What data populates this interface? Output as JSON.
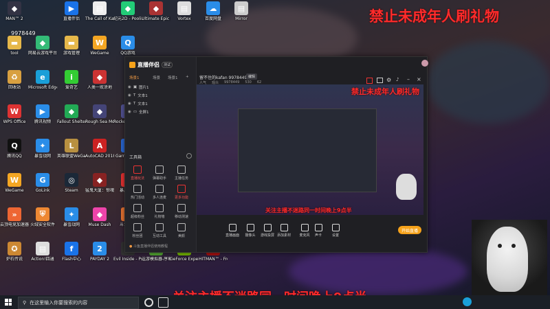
{
  "overlay": {
    "top_right_text": "禁止未成年人刷礼物",
    "preview_text": "禁止未成年人刷礼物",
    "bottom_text": "关注主播不迷路同一时间晚上9点半",
    "bottom_preview_text": "关注主播不迷路同一时间晚上9点半",
    "top_left_number": "9978449"
  },
  "desktop": {
    "icons": [
      {
        "label": "MAN™ 2",
        "icon": "game-icon",
        "color": "#334"
      },
      {
        "label": "直播伴侣",
        "icon": "stream-icon",
        "color": "#1a73e8"
      },
      {
        "label": "The Call of Karen",
        "icon": "doc-icon",
        "color": "#eee"
      },
      {
        "label": "纪元2D - Poolians",
        "icon": "game-icon",
        "color": "#2c7"
      },
      {
        "label": "Ultimate Epic Batt...",
        "icon": "game-icon",
        "color": "#a33"
      },
      {
        "label": "Vortex",
        "icon": "doc-icon",
        "color": "#ddd"
      },
      {
        "label": "百度网盘",
        "icon": "cloud-icon",
        "color": "#2a8de8"
      },
      {
        "label": "Mirror",
        "icon": "doc-icon",
        "color": "#ccc"
      },
      {
        "label": "tool",
        "icon": "folder-icon",
        "color": "#e6b84a"
      },
      {
        "label": "网易云游戏平台",
        "icon": "game-icon",
        "color": "#3b7"
      },
      {
        "label": "游戏管理",
        "icon": "folder-icon",
        "color": "#e6b84a"
      },
      {
        "label": "WeGame",
        "icon": "wegame-icon",
        "color": "#f4a623"
      },
      {
        "label": "QQ游戏",
        "icon": "qq-icon",
        "color": "#2a8de8"
      },
      {
        "label": "回收站",
        "icon": "recycle-icon",
        "color": "#d8a040"
      },
      {
        "label": "Microsoft Edge",
        "icon": "edge-icon",
        "color": "#1a9fd8"
      },
      {
        "label": "爱奇艺",
        "icon": "iqiyi-icon",
        "color": "#3c3"
      },
      {
        "label": "人类一败涂地",
        "icon": "game-icon",
        "color": "#c33"
      },
      {
        "label": "WPS Office",
        "icon": "wps-icon",
        "color": "#d33"
      },
      {
        "label": "腾讯视频",
        "icon": "video-icon",
        "color": "#2a8de8"
      },
      {
        "label": "Fallout Shelter",
        "icon": "game-icon",
        "color": "#2a5"
      },
      {
        "label": "Rough Sea Motor",
        "icon": "game-icon",
        "color": "#447"
      },
      {
        "label": "Rocket Robo...",
        "icon": "game-icon",
        "color": "#559"
      },
      {
        "label": "腾讯QQ",
        "icon": "qq-icon",
        "color": "#111"
      },
      {
        "label": "暴雪战网",
        "icon": "battlenet-icon",
        "color": "#2a8de8"
      },
      {
        "label": "英雄联盟WeGame版",
        "icon": "lol-icon",
        "color": "#b89040"
      },
      {
        "label": "AutoCAD 2018 - 简...",
        "icon": "autocad-icon",
        "color": "#c22"
      },
      {
        "label": "Garry's Mod",
        "icon": "game-icon",
        "color": "#2a6ad8"
      },
      {
        "label": "WeGame",
        "icon": "wegame-icon",
        "color": "#f4a623"
      },
      {
        "label": "GoLink",
        "icon": "golink-icon",
        "color": "#2a8de8"
      },
      {
        "label": "Steam",
        "icon": "steam-icon",
        "color": "#1b2838"
      },
      {
        "label": "猛鬼大厦：惊魂演义版",
        "icon": "game-icon",
        "color": "#822"
      },
      {
        "label": "暴风影音",
        "icon": "video-icon",
        "color": "#e33"
      },
      {
        "label": "云顶电竞加速器",
        "icon": "speed-icon",
        "color": "#e63"
      },
      {
        "label": "火绒安全软件",
        "icon": "shield-icon",
        "color": "#e83"
      },
      {
        "label": "暴雪战网",
        "icon": "battlenet-icon",
        "color": "#2a8de8"
      },
      {
        "label": "Muse Dash",
        "icon": "game-icon",
        "color": "#e4a"
      },
      {
        "label": "斗鱼直播",
        "icon": "douyu-icon",
        "color": "#e73"
      },
      {
        "label": "炉石传说",
        "icon": "hearthstone-icon",
        "color": "#c83"
      },
      {
        "label": "Action!四通",
        "icon": "doc-icon",
        "color": "#ddd"
      },
      {
        "label": "Flash中心",
        "icon": "flash-icon",
        "color": "#1a73e8"
      },
      {
        "label": "PAYDAY 2",
        "icon": "payday-icon",
        "color": "#2a8de8"
      },
      {
        "label": "Evil Inside - Prologue",
        "icon": "game-icon",
        "color": "#333"
      },
      {
        "label": "逗游模拟器-序章",
        "icon": "game-icon",
        "color": "#5a3"
      },
      {
        "label": "GeForce Experience",
        "icon": "nvidia-icon",
        "color": "#76b900"
      },
      {
        "label": "HITMAN™ - Free Trial",
        "icon": "game-icon",
        "color": "#a11"
      }
    ]
  },
  "streamer": {
    "app_logo": "直播伴侣",
    "app_badge": "测试",
    "tabs": [
      "场景1",
      "场景",
      "场景1"
    ],
    "tab_add": "+",
    "scenes": [
      "图片1",
      "文本1",
      "文本1",
      "全屏1"
    ],
    "toolbox_title": "工具箱",
    "tools": [
      "直播玩法",
      "弹幕助手",
      "主播任务",
      "热门活动",
      "多人连麦",
      "更多功能",
      "超级粉丝",
      "礼物墙",
      "移动测速",
      "粉丝团",
      "互动工具",
      "美颜"
    ],
    "bottom_hint": "斗鱼直播伴侣使用教程",
    "room_title": "留不住的kafan 9978449",
    "room_btn": "编辑",
    "stats": [
      "人气",
      "观众",
      "9978449",
      "530",
      "62"
    ],
    "controls": [
      "直播画面",
      "摄像头",
      "游戏投屏",
      "添加素材",
      "麦克风",
      "声卡",
      "设置"
    ],
    "start_button": "开始直播"
  },
  "taskbar": {
    "search_placeholder": "在这里输入你要搜索的内容"
  }
}
